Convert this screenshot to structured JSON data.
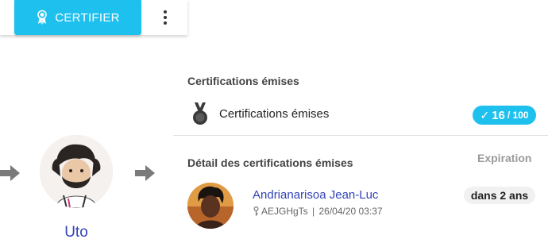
{
  "toolbar": {
    "certify_label": "CERTIFIER",
    "certify_icon": "award-ribbon-icon",
    "more_icon": "more-vertical-icon"
  },
  "flow": {
    "user_name": "Uto"
  },
  "summary": {
    "section_title": "Certifications émises",
    "row_label": "Certifications émises",
    "row_icon": "medal-icon",
    "count": "16",
    "total": "/ 100"
  },
  "details": {
    "section_title": "Détail des certifications émises",
    "expiration_header": "Expiration",
    "items": [
      {
        "name": "Andrianarisoa Jean-Luc",
        "key": "AEJGHgTs",
        "date": "26/04/20 03:37",
        "expiry": "dans 2 ans"
      }
    ]
  },
  "colors": {
    "accent": "#1ec0ee",
    "link": "#3142b6"
  }
}
